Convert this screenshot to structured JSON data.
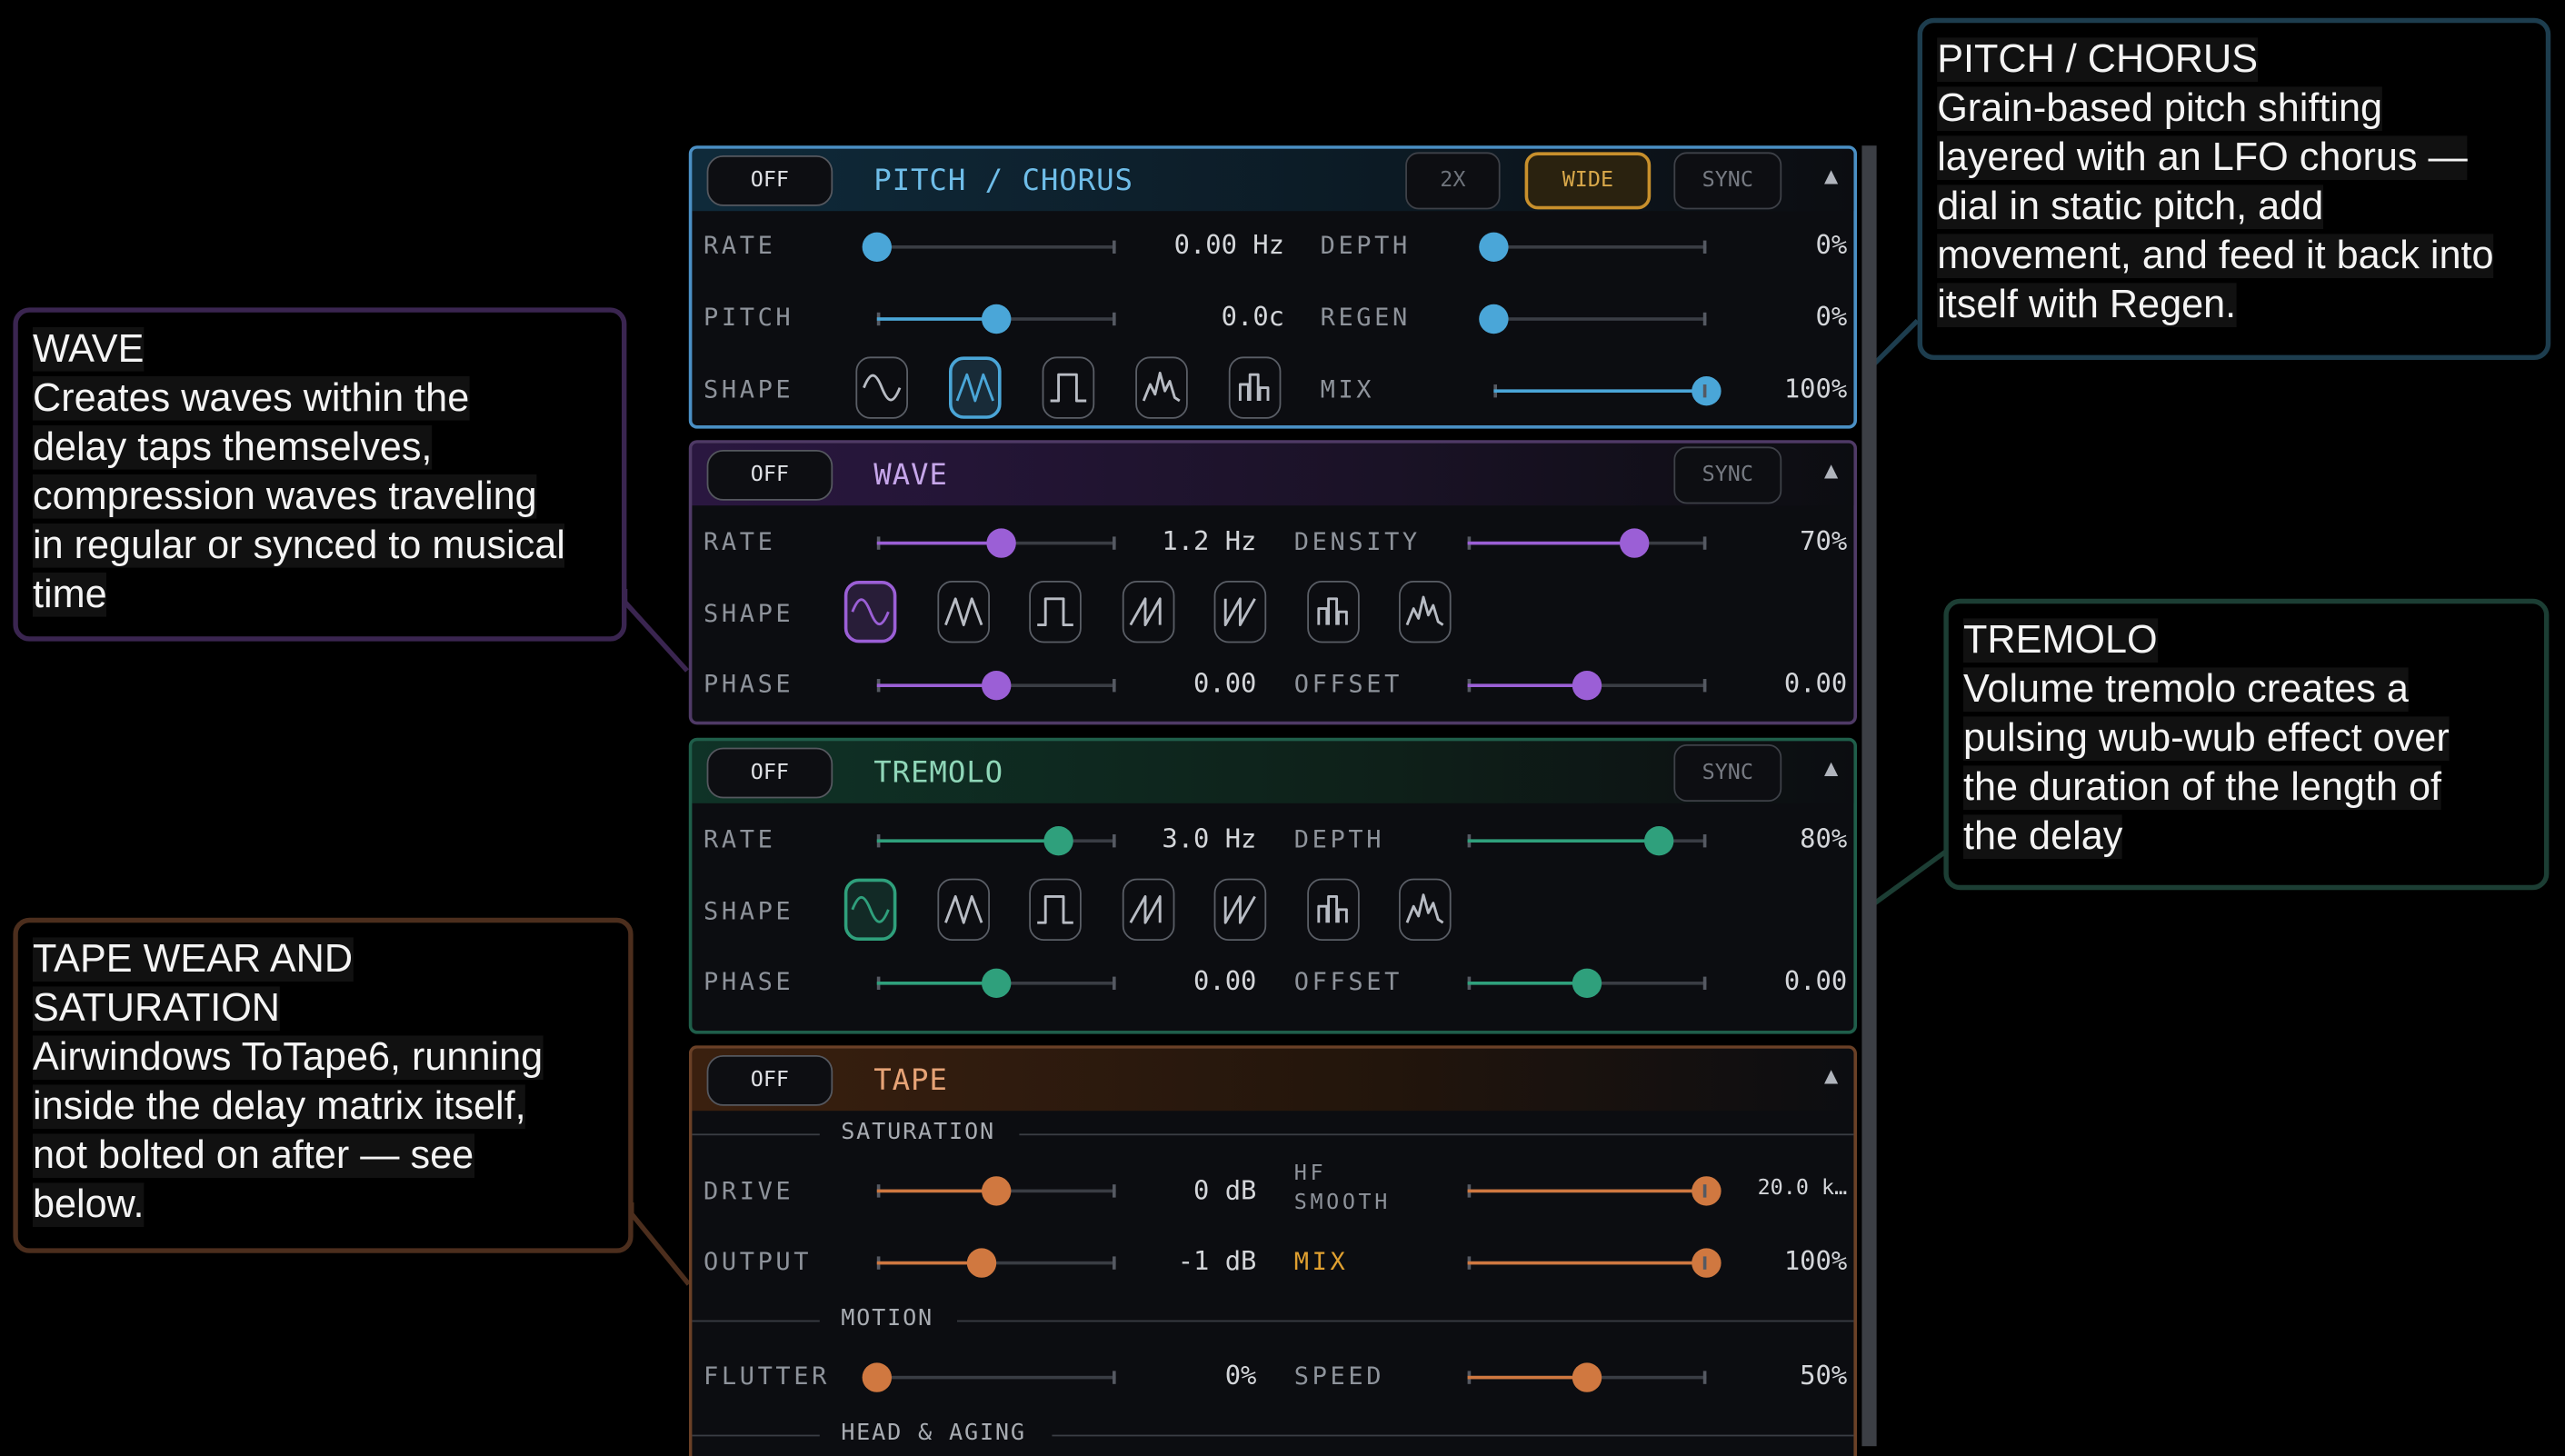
{
  "callouts": {
    "pitch": {
      "title": "PITCH / CHORUS",
      "lines": [
        "Grain-based pitch shifting",
        "layered with an LFO chorus —",
        "dial in static pitch, add",
        "movement, and feed it back into",
        "itself with Regen."
      ]
    },
    "wave": {
      "title": "WAVE",
      "lines": [
        "Creates waves within the",
        "delay taps themselves,",
        "compression waves traveling",
        "in regular or synced to musical",
        "time"
      ]
    },
    "tremolo": {
      "title": "TREMOLO",
      "lines": [
        "Volume tremolo creates a",
        "pulsing wub-wub effect over",
        "the duration of the length of",
        "the delay"
      ]
    },
    "tape": {
      "title_lines": [
        "TAPE WEAR AND",
        "SATURATION"
      ],
      "lines": [
        "Airwindows ToTape6, running",
        "inside the delay matrix itself,",
        "not bolted on after — see",
        "below."
      ]
    }
  },
  "pitch_panel": {
    "off": "OFF",
    "title": "PITCH / CHORUS",
    "btn_2x": "2X",
    "btn_wide": "WIDE",
    "btn_sync": "SYNC",
    "caret": "▲",
    "rate": {
      "label": "RATE",
      "value": "0.00 Hz",
      "level": 0.0
    },
    "pitch": {
      "label": "PITCH",
      "value": "0.0c",
      "level": 0.5
    },
    "shape_label": "SHAPE",
    "shapes": [
      "sine-icon",
      "triangle-icon",
      "square-icon",
      "random-peaks-icon",
      "steps-icon"
    ],
    "selected_shape": 1,
    "depth": {
      "label": "DEPTH",
      "value": "0%",
      "level": 0.0
    },
    "regen": {
      "label": "REGEN",
      "value": "0%",
      "level": 0.0
    },
    "mix": {
      "label": "MIX",
      "value": "100%",
      "level": 1.0
    },
    "accent": "#4aa6d8"
  },
  "wave_panel": {
    "off": "OFF",
    "title": "WAVE",
    "btn_sync": "SYNC",
    "caret": "▲",
    "rate": {
      "label": "RATE",
      "value": "1.2 Hz",
      "level": 0.52
    },
    "density": {
      "label": "DENSITY",
      "value": "70%",
      "level": 0.7
    },
    "shape_label": "SHAPE",
    "shapes": [
      "sine-icon",
      "triangle-icon",
      "square-icon",
      "saw-up-icon",
      "saw-down-icon",
      "steps-icon",
      "random-peaks-icon"
    ],
    "selected_shape": 0,
    "phase": {
      "label": "PHASE",
      "value": "0.00",
      "level": 0.5
    },
    "offset": {
      "label": "OFFSET",
      "value": "0.00",
      "level": 0.5
    },
    "accent": "#9b5fd6"
  },
  "tremolo_panel": {
    "off": "OFF",
    "title": "TREMOLO",
    "btn_sync": "SYNC",
    "caret": "▲",
    "rate": {
      "label": "RATE",
      "value": "3.0 Hz",
      "level": 0.76
    },
    "depth": {
      "label": "DEPTH",
      "value": "80%",
      "level": 0.8
    },
    "shape_label": "SHAPE",
    "shapes": [
      "sine-icon",
      "triangle-icon",
      "square-icon",
      "saw-up-icon",
      "saw-down-icon",
      "steps-icon",
      "random-peaks-icon"
    ],
    "selected_shape": 0,
    "phase": {
      "label": "PHASE",
      "value": "0.00",
      "level": 0.5
    },
    "offset": {
      "label": "OFFSET",
      "value": "0.00",
      "level": 0.5
    },
    "accent": "#2fa07c"
  },
  "tape_panel": {
    "off": "OFF",
    "title": "TAPE",
    "caret": "▲",
    "saturation": "SATURATION",
    "drive": {
      "label": "DRIVE",
      "value": "0 dB",
      "level": 0.5
    },
    "output": {
      "label": "OUTPUT",
      "value": "-1 dB",
      "level": 0.44
    },
    "hf_smooth": {
      "label_1": "HF",
      "label_2": "SMOOTH",
      "value": "20.0 k…",
      "level": 1.0
    },
    "mix": {
      "label": "MIX",
      "value": "100%",
      "level": 1.0
    },
    "motion": "MOTION",
    "flutter": {
      "label": "FLUTTER",
      "value": "0%",
      "level": 0.0
    },
    "speed": {
      "label": "SPEED",
      "value": "50%",
      "level": 0.5
    },
    "head_aging": "HEAD & AGING",
    "accent": "#d07840",
    "mix_label_color": "#e0a030"
  }
}
